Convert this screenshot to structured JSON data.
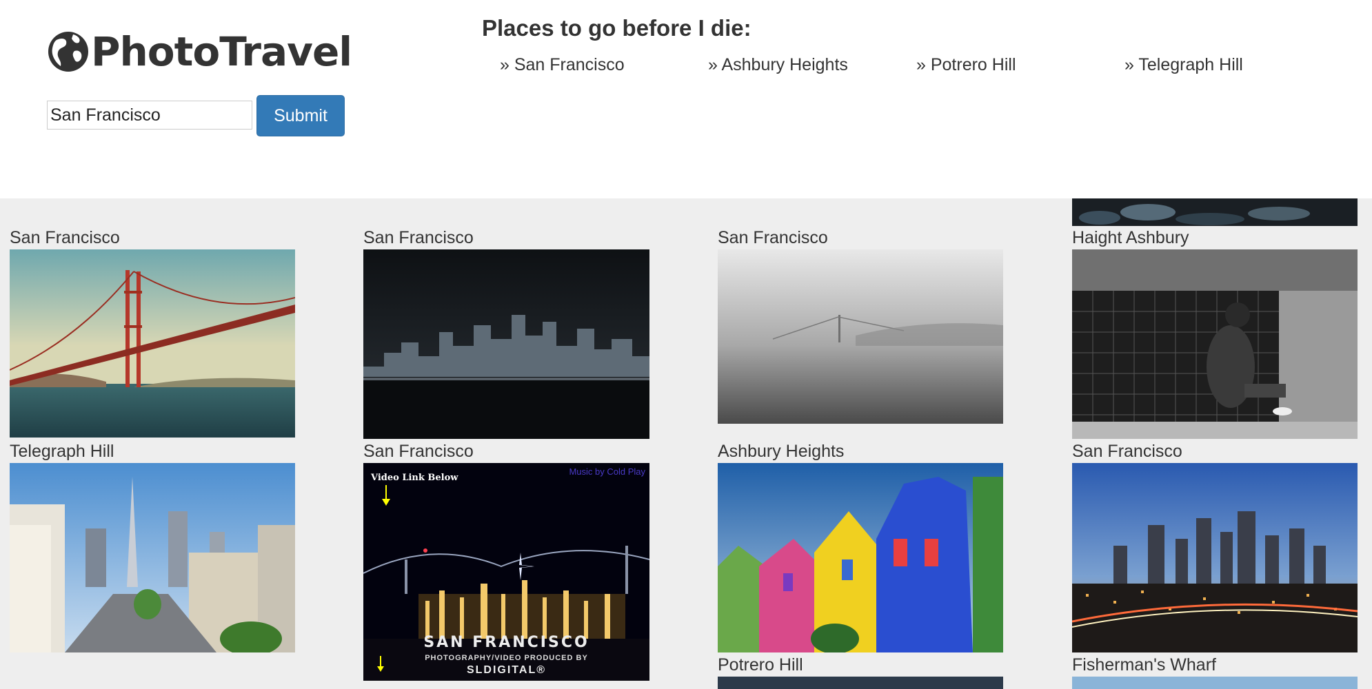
{
  "app": {
    "logo_text": "PhotoTravel",
    "logo_icon": "globe-icon"
  },
  "search": {
    "value": "San Francisco",
    "submit_label": "Submit"
  },
  "places": {
    "heading": "Places to go before I die:",
    "items": [
      {
        "label": "» San Francisco"
      },
      {
        "label": "» Ashbury Heights"
      },
      {
        "label": "» Potrero Hill"
      },
      {
        "label": "» Telegraph Hill"
      }
    ]
  },
  "gallery": {
    "cards": [
      {
        "label": "San Francisco"
      },
      {
        "label": "San Francisco"
      },
      {
        "label": "San Francisco"
      },
      {
        "label": "Haight Ashbury"
      },
      {
        "label": "Telegraph Hill"
      },
      {
        "label": "San Francisco"
      },
      {
        "label": "Ashbury Heights"
      },
      {
        "label": "San Francisco"
      },
      {
        "label": "Potrero Hill"
      },
      {
        "label": "Fisherman's Wharf"
      }
    ],
    "photo_overlays": {
      "video_link": "Video Link Below",
      "music_credit": "Music by Cold Play",
      "video_title": "SAN FRANCISCO",
      "video_subtitle": "PHOTOGRAPHY/VIDEO PRODUCED BY",
      "video_brand": "SLDIGITAL®"
    }
  },
  "colors": {
    "accent": "#337ab7",
    "gallery_bg": "#eeeeee",
    "text": "#333333"
  }
}
